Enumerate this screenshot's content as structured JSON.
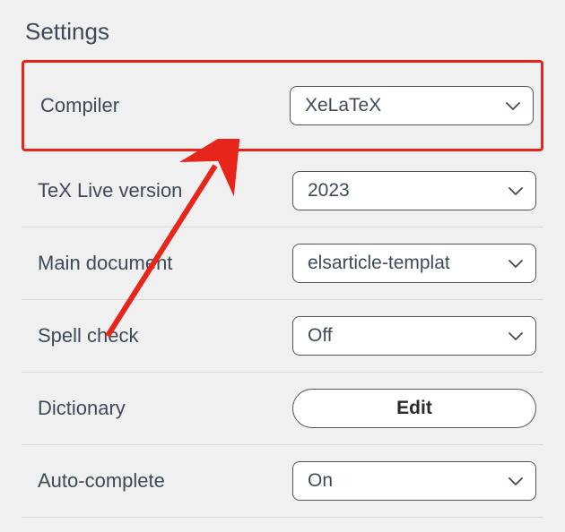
{
  "title": "Settings",
  "rows": {
    "compiler": {
      "label": "Compiler",
      "value": "XeLaTeX"
    },
    "texlive": {
      "label": "TeX Live version",
      "value": "2023"
    },
    "maindoc": {
      "label": "Main document",
      "value": "elsarticle-templat"
    },
    "spellcheck": {
      "label": "Spell check",
      "value": "Off"
    },
    "dictionary": {
      "label": "Dictionary",
      "button": "Edit"
    },
    "autocomplete": {
      "label": "Auto-complete",
      "value": "On"
    }
  }
}
